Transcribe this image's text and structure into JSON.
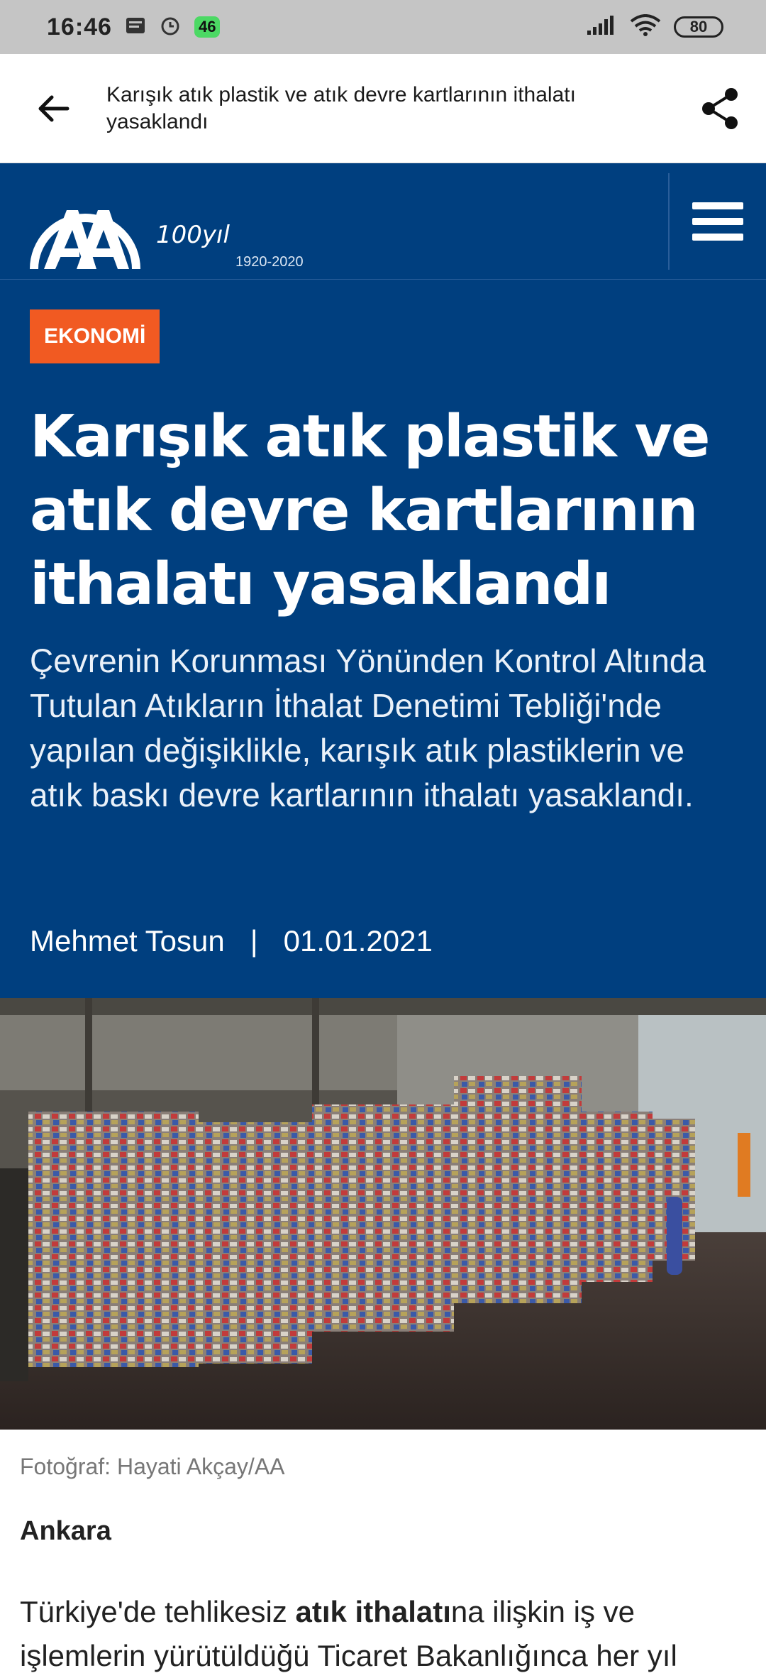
{
  "status_bar": {
    "time": "16:46",
    "badge": "46",
    "battery": "80",
    "icons": [
      "notification-icon",
      "alarm-icon",
      "signal-icon",
      "wifi-icon",
      "battery-icon"
    ]
  },
  "app_bar": {
    "title": "Karışık atık plastik ve atık devre kartlarının ithalatı yasaklandı",
    "back_icon": "arrow-left-icon",
    "share_icon": "share-icon"
  },
  "site_header": {
    "logo_text": "AA",
    "anniversary_number": "100",
    "anniversary_word": "yıl",
    "anniversary_years": "1920-2020",
    "menu_icon": "hamburger-menu-icon",
    "colors": {
      "header_bg": "#003f7f",
      "category_bg": "#f15a22"
    }
  },
  "article": {
    "category": "EKONOMİ",
    "headline": "Karışık atık plastik ve atık devre kartlarının ithalatı yasaklandı",
    "summary": "Çevrenin Korunması Yönünden Kontrol Altında Tutulan Atıkların İthalat Denetimi Tebliği'nde yapılan değişiklikle, karışık atık plastiklerin ve atık baskı devre kartlarının ithalatı yasaklandı.",
    "author": "Mehmet Tosun",
    "separator": "|",
    "date": "01.01.2021",
    "photo_caption": "Fotoğraf: Hayati Akçay/AA",
    "city": "Ankara",
    "body_start_1": "Türkiye'de tehlikesiz ",
    "body_bold": "atık ithalatı",
    "body_start_2": "na ilişkin iş ve işlemlerin yürütüldüğü Ticaret Bakanlığınca her yıl"
  }
}
